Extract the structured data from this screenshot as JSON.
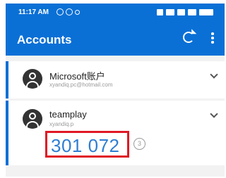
{
  "status_bar": {
    "time": "11:17 AM"
  },
  "app_bar": {
    "title": "Accounts",
    "actions": [
      "refresh-icon",
      "more-vert-icon"
    ]
  },
  "accounts": [
    {
      "name": "Microsoft账户",
      "email": "xyandiq.pc@hotmail.com",
      "expanded": false
    },
    {
      "name": "teamplay",
      "email": "xyandiq.p",
      "code": "301 072",
      "timer": "3",
      "expanded": true
    }
  ],
  "colors": {
    "brand": "#0a70d6",
    "code": "#2f7ed2",
    "highlight": "#e01824"
  }
}
